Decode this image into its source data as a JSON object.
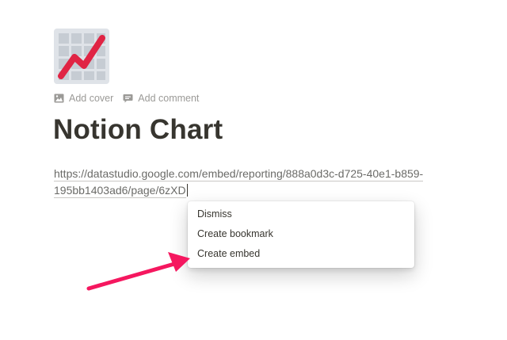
{
  "page": {
    "icon": "chart-increasing-emoji-icon",
    "controls": {
      "add_cover_label": "Add cover",
      "add_comment_label": "Add comment"
    },
    "title": "Notion Chart",
    "url_line_1": "https://datastudio.google.com/embed/reporting/888a0d3c-d725-40e1-b859-",
    "url_line_2": "195bb1403ad6/page/6zXD"
  },
  "paste_menu": {
    "items": [
      {
        "label": "Dismiss"
      },
      {
        "label": "Create bookmark"
      },
      {
        "label": "Create embed"
      }
    ]
  },
  "annotation": {
    "arrow_color": "#f5175f"
  }
}
